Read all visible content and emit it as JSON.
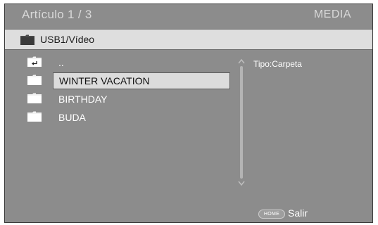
{
  "header": {
    "title": "Artículo 1 / 3",
    "source": "MEDIA"
  },
  "path": {
    "icon": "folder-icon",
    "text": "USB1/Vídeo"
  },
  "items": [
    {
      "label": "..",
      "icon": "parent-folder-icon",
      "selected": false
    },
    {
      "label": "WINTER VACATION",
      "icon": "folder-icon",
      "selected": true
    },
    {
      "label": "BIRTHDAY",
      "icon": "folder-icon",
      "selected": false
    },
    {
      "label": "BUDA",
      "icon": "folder-icon",
      "selected": false
    }
  ],
  "info": {
    "type_text": "Tipo:Carpeta"
  },
  "footer": {
    "home_key": "HOME",
    "exit_label": "Salir"
  },
  "colors": {
    "background": "#8c8c8c",
    "pathbar": "#dedede",
    "selection": "#dcdcdc",
    "text": "#ffffff"
  }
}
